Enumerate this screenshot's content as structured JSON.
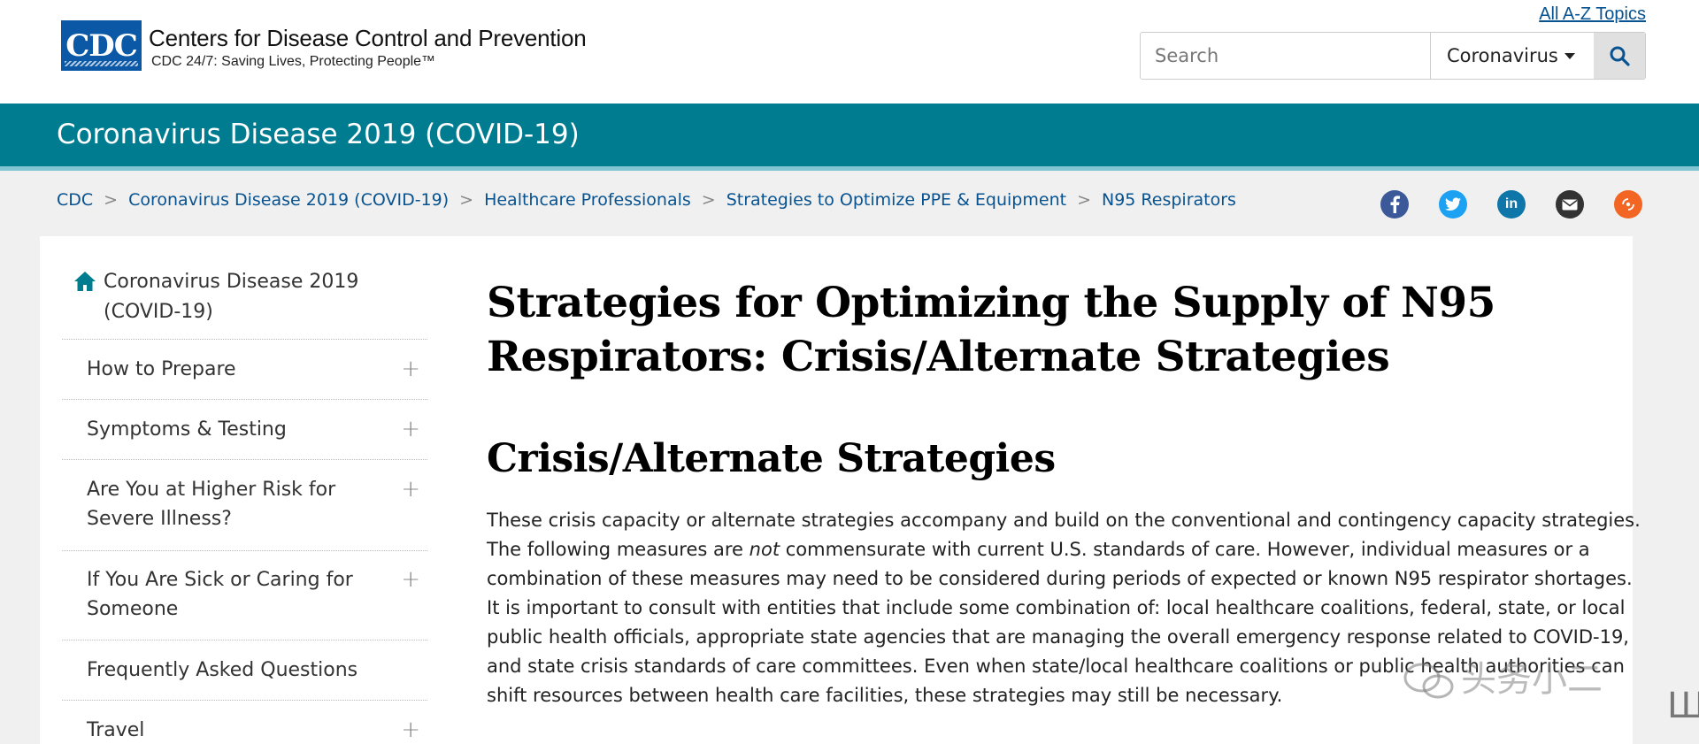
{
  "header": {
    "logo_text": "CDC",
    "org_name": "Centers for Disease Control and Prevention",
    "tagline": "CDC 24/7: Saving Lives, Protecting People™",
    "az_link": "All A-Z Topics",
    "search": {
      "placeholder": "Search",
      "scope": "Coronavirus"
    }
  },
  "band": {
    "title": "Coronavirus Disease 2019 (COVID-19)"
  },
  "breadcrumb": [
    "CDC",
    "Coronavirus Disease 2019 (COVID-19)",
    "Healthcare Professionals",
    "Strategies to Optimize PPE & Equipment",
    "N95 Respirators"
  ],
  "breadcrumb_separator": ">",
  "social_icons": [
    "facebook-icon",
    "twitter-icon",
    "linkedin-icon",
    "email-icon",
    "syndicate-icon"
  ],
  "sidebar": {
    "home_label": "Coronavirus Disease 2019 (COVID-19)",
    "items": [
      {
        "label": "How to Prepare",
        "expandable": true
      },
      {
        "label": "Symptoms & Testing",
        "expandable": true
      },
      {
        "label": "Are You at Higher Risk for Severe Illness?",
        "expandable": true
      },
      {
        "label": "If You Are Sick or Caring for Someone",
        "expandable": true
      },
      {
        "label": "Frequently Asked Questions",
        "expandable": false
      },
      {
        "label": "Travel",
        "expandable": true
      }
    ],
    "expand_glyph": "+"
  },
  "main": {
    "title_line1": "Strategies for Optimizing the Supply of N95",
    "title_line2": "Respirators: Crisis/Alternate Strategies",
    "subheading": "Crisis/Alternate Strategies",
    "paragraph_lines": [
      "These crisis capacity or alternate strategies accompany and build on the conventional and contingency capacity strategies.",
      "combination of these measures may need to be considered during periods of expected or known N95 respirator shortages.",
      "It is important to consult with entities that include some combination of: local healthcare coalitions, federal, state, or local",
      "public health officials, appropriate state agencies that are managing the overall emergency response related to COVID-19,",
      "and state crisis standards of care committees. Even when state/local healthcare coalitions or public health authorities can",
      "shift resources between health care facilities, these strategies may still be necessary."
    ],
    "line2_before": "The following measures are ",
    "line2_em": "not",
    "line2_after": " commensurate with current U.S. standards of care. However, individual measures or a"
  },
  "watermark": "头务小二",
  "colors": {
    "band": "#007c91",
    "link": "#075290",
    "logo": "#0a58a6"
  }
}
